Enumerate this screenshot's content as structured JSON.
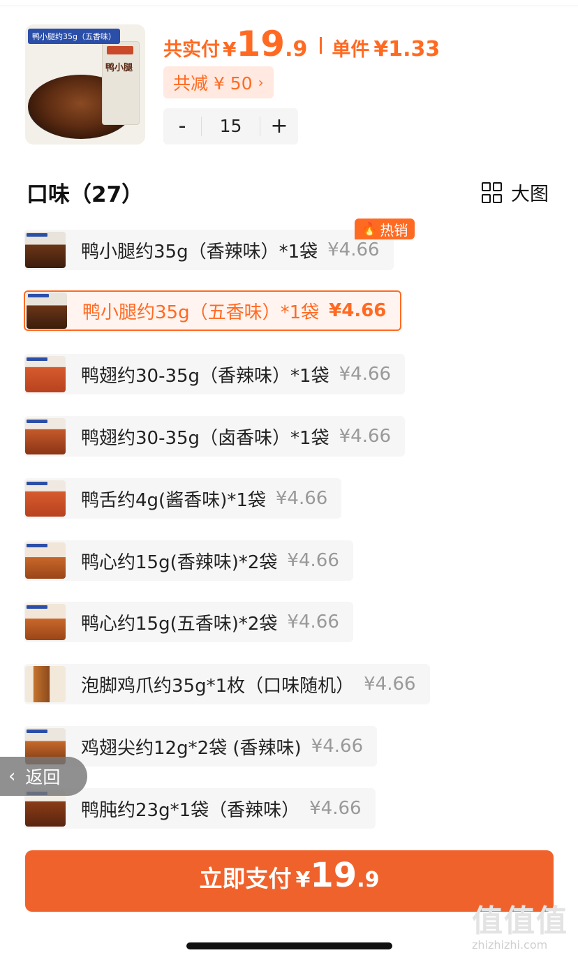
{
  "product": {
    "thumb_tag": "鸭小腿约35g（五香味）",
    "thumb_pack_text": "鸭小腿"
  },
  "pay_summary": {
    "label": "共实付",
    "currency": "¥",
    "total_int": "19",
    "total_dec": ".9",
    "unit_label": "单件",
    "unit_price": "¥1.33",
    "discount": "共减 ¥ 50",
    "discount_chevron": "›"
  },
  "stepper": {
    "minus": "-",
    "quantity": "15",
    "plus": "+"
  },
  "flavors": {
    "title": "口味（27）",
    "big_view": "大图",
    "hot_badge": "热销",
    "items": [
      {
        "name": "鸭小腿约35g（香辣味）*1袋",
        "price": "¥4.66"
      },
      {
        "name": "鸭小腿约35g（五香味）*1袋",
        "price": "¥4.66"
      },
      {
        "name": "鸭翅约30-35g（香辣味）*1袋",
        "price": "¥4.66"
      },
      {
        "name": "鸭翅约30-35g（卤香味）*1袋",
        "price": "¥4.66"
      },
      {
        "name": "鸭舌约4g(酱香味)*1袋",
        "price": "¥4.66"
      },
      {
        "name": "鸭心约15g(香辣味)*2袋",
        "price": "¥4.66"
      },
      {
        "name": "鸭心约15g(五香味)*2袋",
        "price": "¥4.66"
      },
      {
        "name": "泡脚鸡爪约35g*1枚（口味随机）",
        "price": "¥4.66"
      },
      {
        "name": "鸡翅尖约12g*2袋 (香辣味)",
        "price": "¥4.66"
      },
      {
        "name": "鸭肫约23g*1袋（香辣味）",
        "price": "¥4.66"
      }
    ]
  },
  "back_button": "返回",
  "pay_button": {
    "label": "立即支付",
    "currency": "¥",
    "int": "19",
    "dec": ".9"
  },
  "watermark": {
    "logo": "值值值",
    "url": "zhizhizhi.com"
  },
  "colors": {
    "accent": "#ff6a22",
    "pay_button": "#f0622c",
    "discount_bg": "#ffe9e0",
    "option_bg": "#f6f6f6"
  }
}
